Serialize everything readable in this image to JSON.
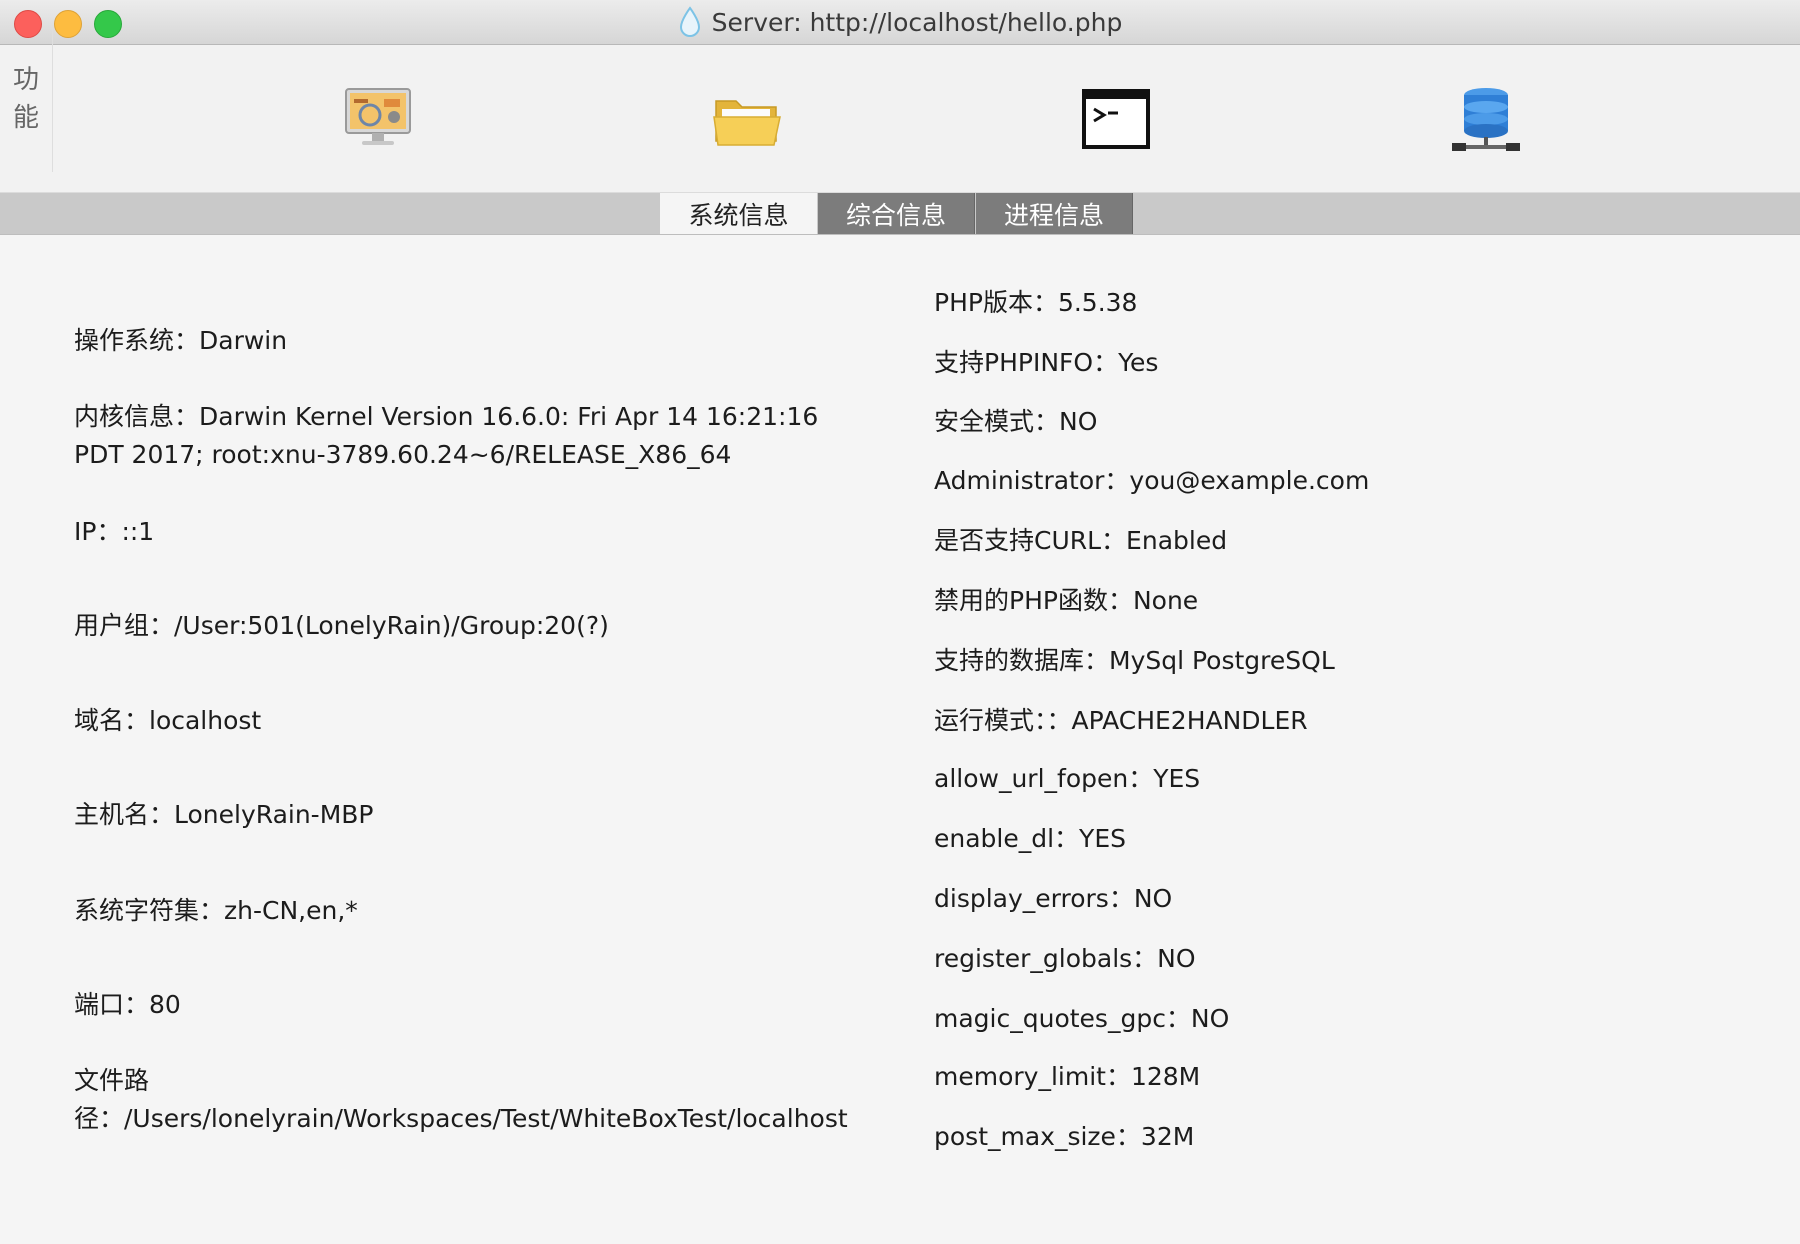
{
  "window": {
    "title": "Server: http://localhost/hello.php"
  },
  "toolbar": {
    "side_label_1": "功",
    "side_label_2": "能",
    "buttons": [
      {
        "icon": "monitor-dashboard-icon"
      },
      {
        "icon": "folder-icon"
      },
      {
        "icon": "terminal-icon"
      },
      {
        "icon": "database-icon"
      }
    ]
  },
  "tabs": [
    {
      "label": "系统信息",
      "active": true
    },
    {
      "label": "综合信息",
      "active": false
    },
    {
      "label": "进程信息",
      "active": false
    }
  ],
  "left": {
    "os": "操作系统：Darwin",
    "kernel": "内核信息：Darwin Kernel Version 16.6.0: Fri Apr 14 16:21:16 PDT 2017; root:xnu-3789.60.24~6/RELEASE_X86_64",
    "ip": "IP：::1",
    "usergroup": "用户组：/User:501(LonelyRain)/Group:20(?)",
    "domain": "域名：localhost",
    "hostname": "主机名：LonelyRain-MBP",
    "charset": "系统字符集：zh-CN,en,*",
    "port": "端口：80",
    "path": "文件路径：/Users/lonelyrain/Workspaces/Test/WhiteBoxTest/localhost"
  },
  "right": [
    "PHP版本：5.5.38",
    "支持PHPINFO：Yes",
    "安全模式：NO",
    "Administrator：you@example.com",
    "是否支持CURL：Enabled",
    "禁用的PHP函数：None",
    "支持的数据库：MySql PostgreSQL",
    "运行模式：：APACHE2HANDLER",
    "allow_url_fopen：YES",
    "enable_dl：YES",
    "display_errors：NO",
    "register_globals：NO",
    "magic_quotes_gpc：NO",
    "memory_limit：128M",
    "post_max_size：32M"
  ],
  "colors": {
    "close": "#fc605c",
    "minimize": "#fdbc40",
    "maximize": "#34c84a",
    "tab_inactive": "#7c7c7c"
  }
}
